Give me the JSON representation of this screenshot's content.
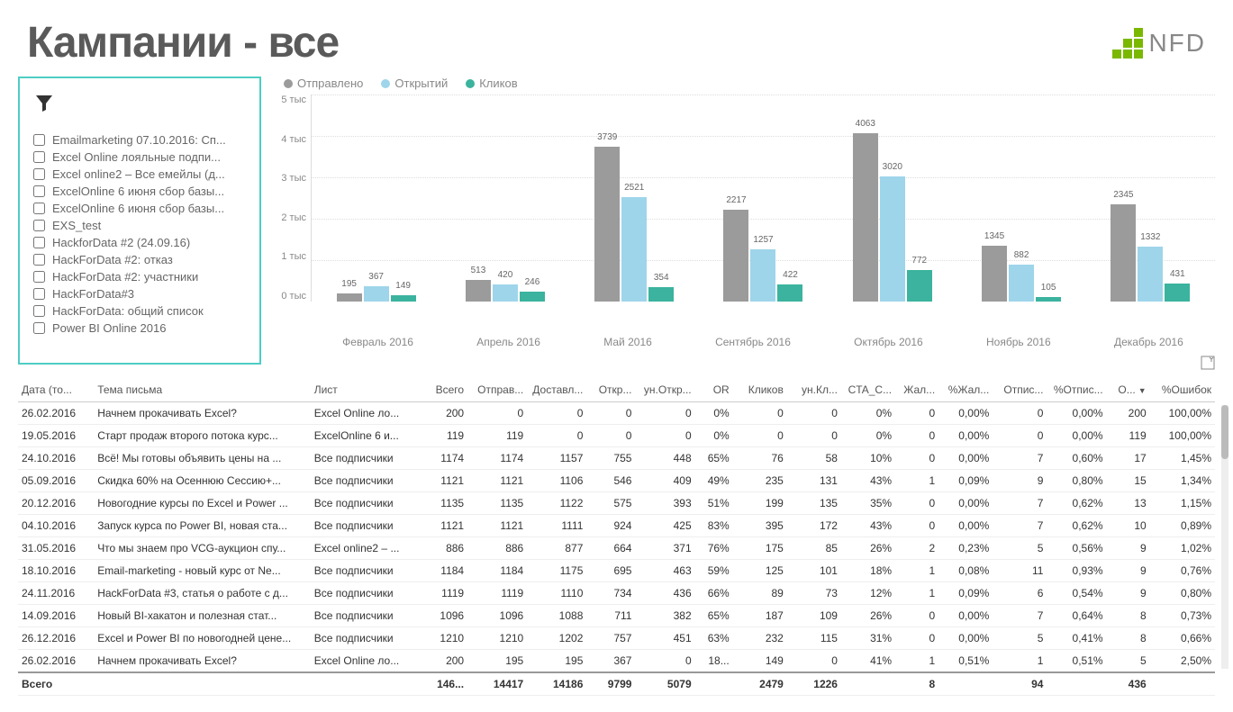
{
  "title": "Кампании - все",
  "logo_text": "NFD",
  "filter": {
    "items": [
      "Emailmarketing 07.10.2016: Сп...",
      "Excel Online лояльные подпи...",
      "Excel online2 – Все емейлы (д...",
      "ExcelOnline 6 июня сбор базы...",
      "ExcelOnline 6 июня сбор базы...",
      "EXS_test",
      "HackforData #2 (24.09.16)",
      "HackForData #2: отказ",
      "HackForData #2: участники",
      "HackForData#3",
      "HackForData: общий список",
      "Power BI Online 2016"
    ]
  },
  "legend": {
    "sent": "Отправлено",
    "opens": "Открытий",
    "clicks": "Кликов"
  },
  "colors": {
    "sent": "#9b9b9b",
    "opens": "#9ed5ea",
    "clicks": "#3bb39e"
  },
  "chart_data": {
    "type": "bar",
    "ylabel": "",
    "ylim": [
      0,
      5000
    ],
    "yticks": [
      "5 тыс",
      "4 тыс",
      "3 тыс",
      "2 тыс",
      "1 тыс",
      "0 тыс"
    ],
    "categories": [
      "Февраль 2016",
      "Апрель 2016",
      "Май 2016",
      "Сентябрь 2016",
      "Октябрь 2016",
      "Ноябрь 2016",
      "Декабрь 2016"
    ],
    "series": [
      {
        "name": "Отправлено",
        "values": [
          195,
          513,
          3739,
          2217,
          4063,
          1345,
          2345
        ]
      },
      {
        "name": "Открытий",
        "values": [
          367,
          420,
          2521,
          1257,
          3020,
          882,
          1332
        ]
      },
      {
        "name": "Кликов",
        "values": [
          149,
          246,
          354,
          422,
          772,
          105,
          431
        ]
      }
    ]
  },
  "table": {
    "headers": [
      "Дата (то...",
      "Тема письма",
      "Лист",
      "Всего",
      "Отправ...",
      "Доставл...",
      "Откр...",
      "ун.Откр...",
      "OR",
      "Кликов",
      "ун.Кл...",
      "CTA_C...",
      "Жал...",
      "%Жал...",
      "Отпис...",
      "%Отпис...",
      "О...",
      "%Ошибок"
    ],
    "sorted_col": 16,
    "rows": [
      [
        "26.02.2016",
        "Начнем прокачивать Excel?",
        "Excel Online ло...",
        "200",
        "0",
        "0",
        "0",
        "0",
        "0%",
        "0",
        "0",
        "0%",
        "0",
        "0,00%",
        "0",
        "0,00%",
        "200",
        "100,00%"
      ],
      [
        "19.05.2016",
        "Старт продаж второго потока курс...",
        "ExcelOnline 6 и...",
        "119",
        "119",
        "0",
        "0",
        "0",
        "0%",
        "0",
        "0",
        "0%",
        "0",
        "0,00%",
        "0",
        "0,00%",
        "119",
        "100,00%"
      ],
      [
        "24.10.2016",
        "Всё! Мы готовы объявить цены на ...",
        "Все подписчики",
        "1174",
        "1174",
        "1157",
        "755",
        "448",
        "65%",
        "76",
        "58",
        "10%",
        "0",
        "0,00%",
        "7",
        "0,60%",
        "17",
        "1,45%"
      ],
      [
        "05.09.2016",
        "Скидка 60% на Осеннюю Сессию+...",
        "Все подписчики",
        "1121",
        "1121",
        "1106",
        "546",
        "409",
        "49%",
        "235",
        "131",
        "43%",
        "1",
        "0,09%",
        "9",
        "0,80%",
        "15",
        "1,34%"
      ],
      [
        "20.12.2016",
        "Новогодние курсы по Excel и Power ...",
        "Все подписчики",
        "1135",
        "1135",
        "1122",
        "575",
        "393",
        "51%",
        "199",
        "135",
        "35%",
        "0",
        "0,00%",
        "7",
        "0,62%",
        "13",
        "1,15%"
      ],
      [
        "04.10.2016",
        "Запуск курса по Power BI, новая ста...",
        "Все подписчики",
        "1121",
        "1121",
        "1111",
        "924",
        "425",
        "83%",
        "395",
        "172",
        "43%",
        "0",
        "0,00%",
        "7",
        "0,62%",
        "10",
        "0,89%"
      ],
      [
        "31.05.2016",
        "Что мы знаем про VCG-аукцион спу...",
        "Excel online2 – ...",
        "886",
        "886",
        "877",
        "664",
        "371",
        "76%",
        "175",
        "85",
        "26%",
        "2",
        "0,23%",
        "5",
        "0,56%",
        "9",
        "1,02%"
      ],
      [
        "18.10.2016",
        "Email-marketing - новый курс от Ne...",
        "Все подписчики",
        "1184",
        "1184",
        "1175",
        "695",
        "463",
        "59%",
        "125",
        "101",
        "18%",
        "1",
        "0,08%",
        "11",
        "0,93%",
        "9",
        "0,76%"
      ],
      [
        "24.11.2016",
        "HackForData #3, статья о работе с д...",
        "Все подписчики",
        "1119",
        "1119",
        "1110",
        "734",
        "436",
        "66%",
        "89",
        "73",
        "12%",
        "1",
        "0,09%",
        "6",
        "0,54%",
        "9",
        "0,80%"
      ],
      [
        "14.09.2016",
        "Новый BI-хакатон и полезная стат...",
        "Все подписчики",
        "1096",
        "1096",
        "1088",
        "711",
        "382",
        "65%",
        "187",
        "109",
        "26%",
        "0",
        "0,00%",
        "7",
        "0,64%",
        "8",
        "0,73%"
      ],
      [
        "26.12.2016",
        "Excel и Power BI по новогодней цене...",
        "Все подписчики",
        "1210",
        "1210",
        "1202",
        "757",
        "451",
        "63%",
        "232",
        "115",
        "31%",
        "0",
        "0,00%",
        "5",
        "0,41%",
        "8",
        "0,66%"
      ],
      [
        "26.02.2016",
        "Начнем прокачивать Excel?",
        "Excel Online ло...",
        "200",
        "195",
        "195",
        "367",
        "0",
        "18...",
        "149",
        "0",
        "41%",
        "1",
        "0,51%",
        "1",
        "0,51%",
        "5",
        "2,50%"
      ]
    ],
    "footer": [
      "Всего",
      "",
      "",
      "146...",
      "14417",
      "14186",
      "9799",
      "5079",
      "",
      "2479",
      "1226",
      "",
      "8",
      "",
      "94",
      "",
      "436",
      ""
    ]
  }
}
